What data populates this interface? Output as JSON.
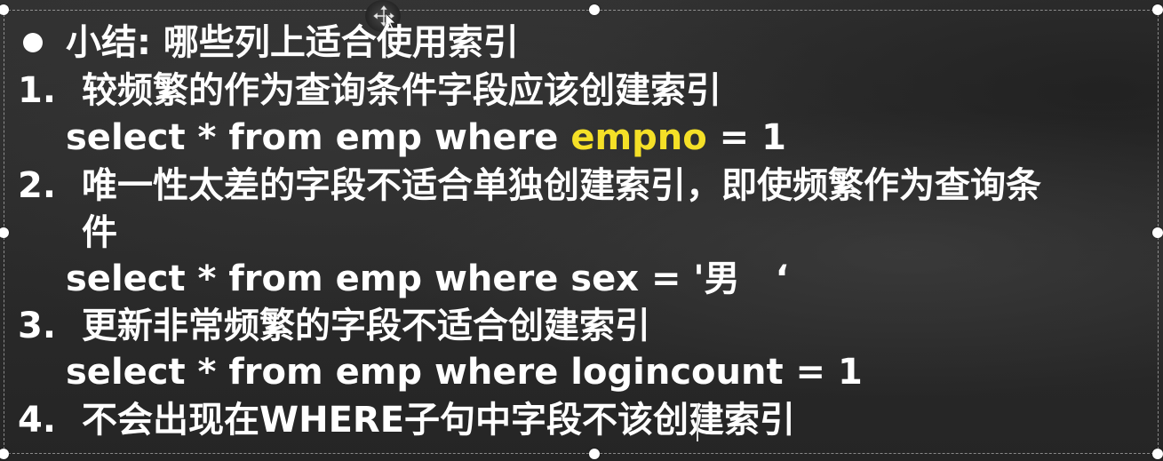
{
  "slide": {
    "heading": "小结: 哪些列上适合使用索引",
    "items": [
      {
        "number": "1.",
        "text": "较频繁的作为查询条件字段应该创建索引",
        "code_prefix": "select * from emp where ",
        "code_highlight": "empno",
        "code_suffix": " = 1"
      },
      {
        "number": "2.",
        "text_line1": "唯一性太差的字段不适合单独创建索引，即使频繁作为查询条",
        "text_line2": "件",
        "code": "select * from emp where sex = '男　‘"
      },
      {
        "number": "3.",
        "text": "更新非常频繁的字段不适合创建索引",
        "code": "select * from emp where logincount = 1"
      },
      {
        "number": "4.",
        "text": "不会出现在WHERE子句中字段不该创建索引"
      }
    ],
    "highlight_color": "#f5e027"
  },
  "icons": {
    "rotate": "move-cursor-icon",
    "bullet": "bullet-dot-icon"
  }
}
